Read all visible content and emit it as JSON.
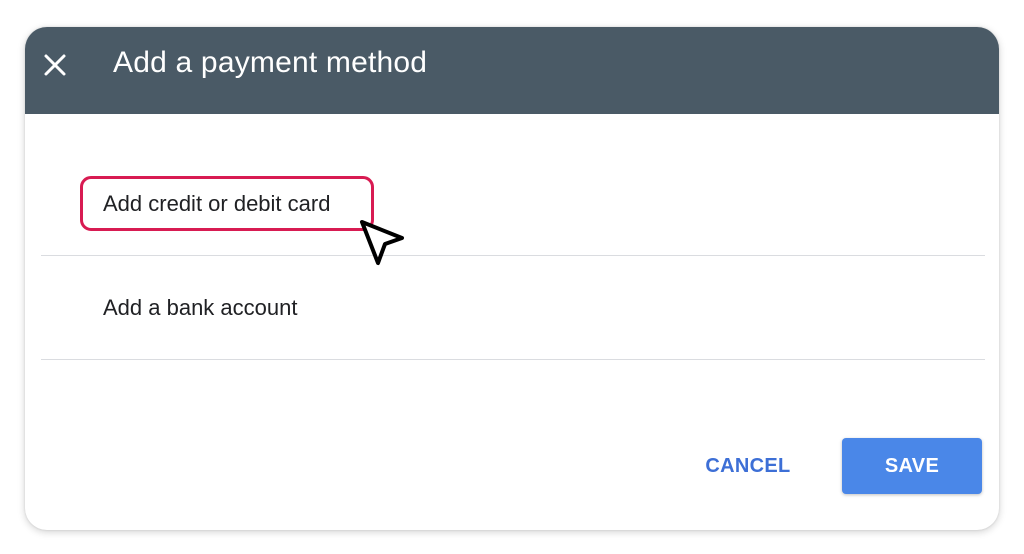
{
  "dialog": {
    "title": "Add a payment method",
    "close_icon": "close-icon",
    "header_color": "#4a5a66"
  },
  "options": [
    {
      "label": "Add credit or debit card",
      "highlighted": true
    },
    {
      "label": "Add a bank account",
      "highlighted": false
    }
  ],
  "highlight_color": "#d81b52",
  "actions": {
    "cancel_label": "CANCEL",
    "save_label": "SAVE",
    "accent_color": "#3d6fd6",
    "save_color": "#4a87e8"
  },
  "pointer_icon": "mouse-pointer-icon"
}
